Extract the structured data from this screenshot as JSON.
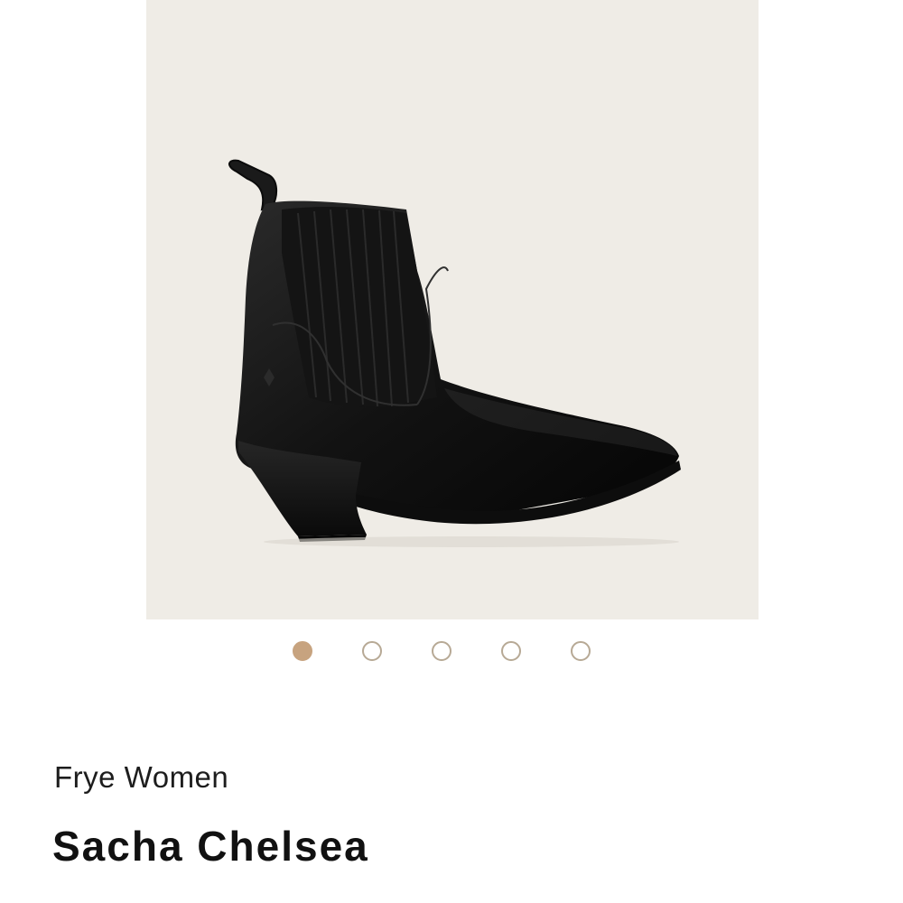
{
  "product": {
    "brand": "Frye Women",
    "name": "Sacha Chelsea"
  },
  "gallery": {
    "image_count": 5,
    "active_index": 0,
    "image_icon": "boot-photo",
    "background_color": "#efece6",
    "active_dot_color": "#c7a37f",
    "inactive_dot_border_color": "#b7a995"
  }
}
